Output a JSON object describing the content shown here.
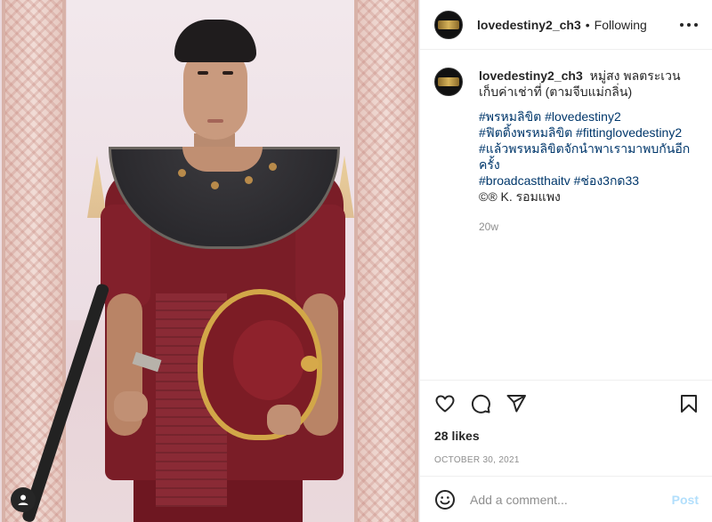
{
  "post": {
    "username": "lovedestiny2_ch3",
    "follow_status": "Following",
    "separator": "•",
    "caption": {
      "username": "lovedestiny2_ch3",
      "text": "หมู่สง พลตระเวนเก็บค่าเช่าที่ (ตามจีบแม่กลิ่น)",
      "tags": [
        "#พรหมลิขิต #lovedestiny2",
        "#ฟิตติ้งพรหมลิขิต #fittinglovedestiny2",
        "#แล้วพรหมลิขิตจักนำพาเรามาพบกันอีกครั้ง",
        "#broadcastthaitv #ช่อง3กด33"
      ],
      "credit": "©® K. รอมแพง",
      "time_ago": "20w"
    },
    "likes": "28 likes",
    "date": "OCTOBER 30, 2021"
  },
  "icons": {
    "like": "heart-icon",
    "comment": "comment-icon",
    "share": "paper-plane-icon",
    "save": "bookmark-icon",
    "emoji": "smiley-icon",
    "more": "more-options-icon",
    "user_tag": "user-tag-icon"
  },
  "comment_box": {
    "placeholder": "Add a comment...",
    "post_label": "Post"
  },
  "colors": {
    "link": "#00376b",
    "muted": "#8e8e8e",
    "post_disabled": "#b2dffc",
    "text": "#262626"
  }
}
